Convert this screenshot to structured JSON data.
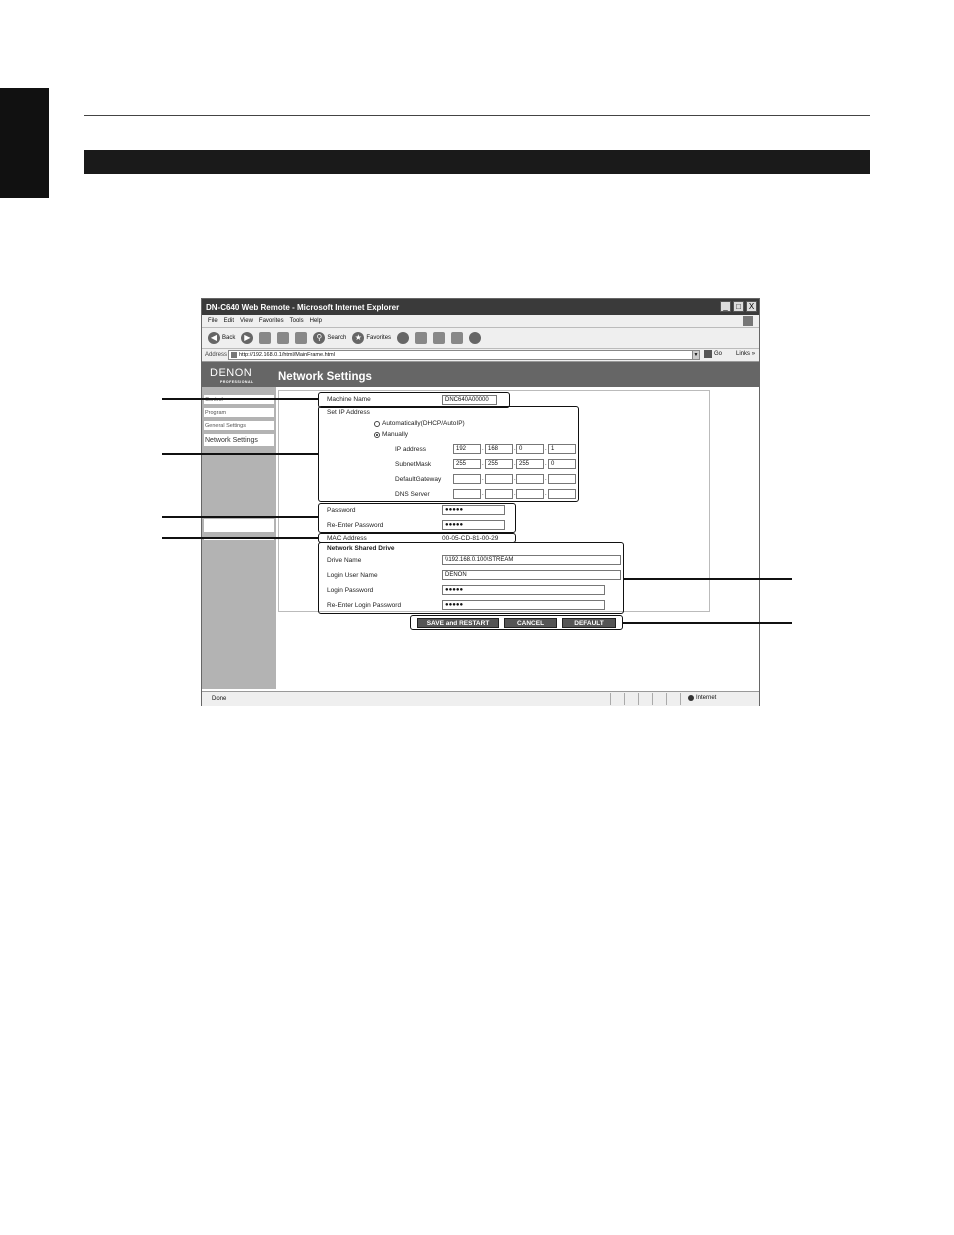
{
  "browser": {
    "title": "DN-C640 Web Remote - Microsoft Internet Explorer",
    "window_buttons": [
      "_",
      "□",
      "X"
    ],
    "menu": [
      "File",
      "Edit",
      "View",
      "Favorites",
      "Tools",
      "Help"
    ],
    "toolbar": {
      "back": "Back",
      "search": "Search",
      "favorites": "Favorites"
    },
    "address_label": "Address",
    "address_value": "http://192.168.0.1/html/MainFrame.html",
    "go_label": "Go",
    "links_label": "Links",
    "links_chevron": "»",
    "status": "Done",
    "zone": "Internet"
  },
  "app": {
    "logo": "DENON",
    "logo_sub": "PROFESSIONAL",
    "page_title": "Network Settings"
  },
  "nav": [
    {
      "label": "Control"
    },
    {
      "label": "Program"
    },
    {
      "label": "General Settings"
    },
    {
      "label": "Network Settings"
    }
  ],
  "form": {
    "machine_name": {
      "label": "Machine Name",
      "value": "DNC640A00000"
    },
    "set_ip": {
      "label": "Set IP Address",
      "option_auto": "Automatically(DHCP/AutoIP)",
      "option_manual": "Manually",
      "ip_label": "IP address",
      "ip": [
        "192",
        "168",
        "0",
        "1"
      ],
      "subnet_label": "SubnetMask",
      "subnet": [
        "255",
        "255",
        "255",
        "0"
      ],
      "gateway_label": "DefaultGateway",
      "dns_label": "DNS Server"
    },
    "password": {
      "label": "Password",
      "value": "●●●●●"
    },
    "reenter_password": {
      "label": "Re-Enter Password",
      "value": "●●●●●"
    },
    "mac": {
      "label": "MAC Address",
      "value": "00-05-CD-81-00-29"
    },
    "shared_drive": {
      "heading": "Network Shared Drive",
      "drive_label": "Drive Name",
      "drive_value": "\\\\192.168.0.100\\STREAM",
      "login_user_label": "Login User Name",
      "login_user_value": "DENON",
      "login_password_label": "Login Password",
      "login_password_value": "●●●●●",
      "reenter_login_label": "Re-Enter Login Password",
      "reenter_login_value": "●●●●●"
    },
    "ip_separator": ".",
    "buttons": {
      "save": "SAVE and RESTART",
      "cancel": "CANCEL",
      "default": "DEFAULT"
    }
  },
  "colors": {
    "banner": "#666666",
    "nav_bg": "#b3b3b3",
    "button": "#555555"
  }
}
